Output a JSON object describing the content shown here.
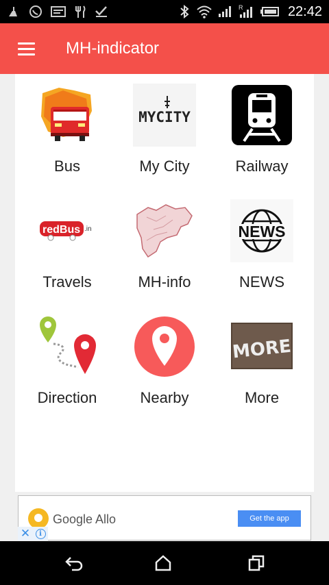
{
  "status_bar": {
    "time": "22:42",
    "left_icons": [
      "clean-icon",
      "whatsapp-icon",
      "message-icon",
      "restaurant-icon",
      "check-icon"
    ],
    "right_icons": [
      "bluetooth-icon",
      "wifi-icon",
      "signal-icon",
      "roaming-signal-icon",
      "battery-icon"
    ]
  },
  "app_bar": {
    "title": "MH-indicator",
    "menu_icon": "hamburger-menu-icon",
    "color": "#f4504a"
  },
  "grid": {
    "items": [
      {
        "label": "Bus",
        "icon": "bus-icon"
      },
      {
        "label": "My City",
        "icon": "mycity-icon",
        "icon_text": "MYCITY"
      },
      {
        "label": "Railway",
        "icon": "train-icon"
      },
      {
        "label": "Travels",
        "icon": "redbus-icon",
        "icon_text": "redBus",
        "icon_suffix": ".in"
      },
      {
        "label": "MH-info",
        "icon": "maharashtra-map-icon"
      },
      {
        "label": "NEWS",
        "icon": "news-globe-icon",
        "icon_text": "NEWS"
      },
      {
        "label": "Direction",
        "icon": "direction-pins-icon"
      },
      {
        "label": "Nearby",
        "icon": "location-pin-icon"
      },
      {
        "label": "More",
        "icon": "more-banner-icon",
        "icon_text": "MORE"
      }
    ]
  },
  "ad": {
    "brand": "Google Allo",
    "cta": "Get the app",
    "close_icon": "close-icon",
    "info_icon": "info-icon",
    "info_text": "i"
  },
  "nav_bar": {
    "icons": [
      "back-icon",
      "home-icon",
      "recents-icon"
    ]
  }
}
